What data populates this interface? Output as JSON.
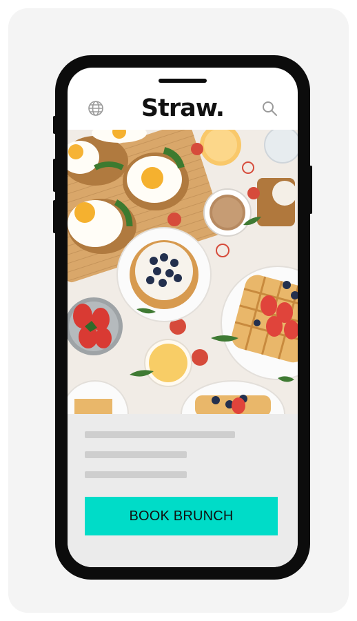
{
  "app": {
    "logo_text": "Straw."
  },
  "header": {
    "globe_icon": "globe-icon",
    "search_icon": "search-icon"
  },
  "hero": {
    "image_subject": "brunch-table-photo"
  },
  "content": {
    "cta_label": "BOOK BRUNCH"
  },
  "colors": {
    "cta": "#00dcc8",
    "device_frame": "#0c0c0c",
    "placeholder": "#cecece"
  }
}
